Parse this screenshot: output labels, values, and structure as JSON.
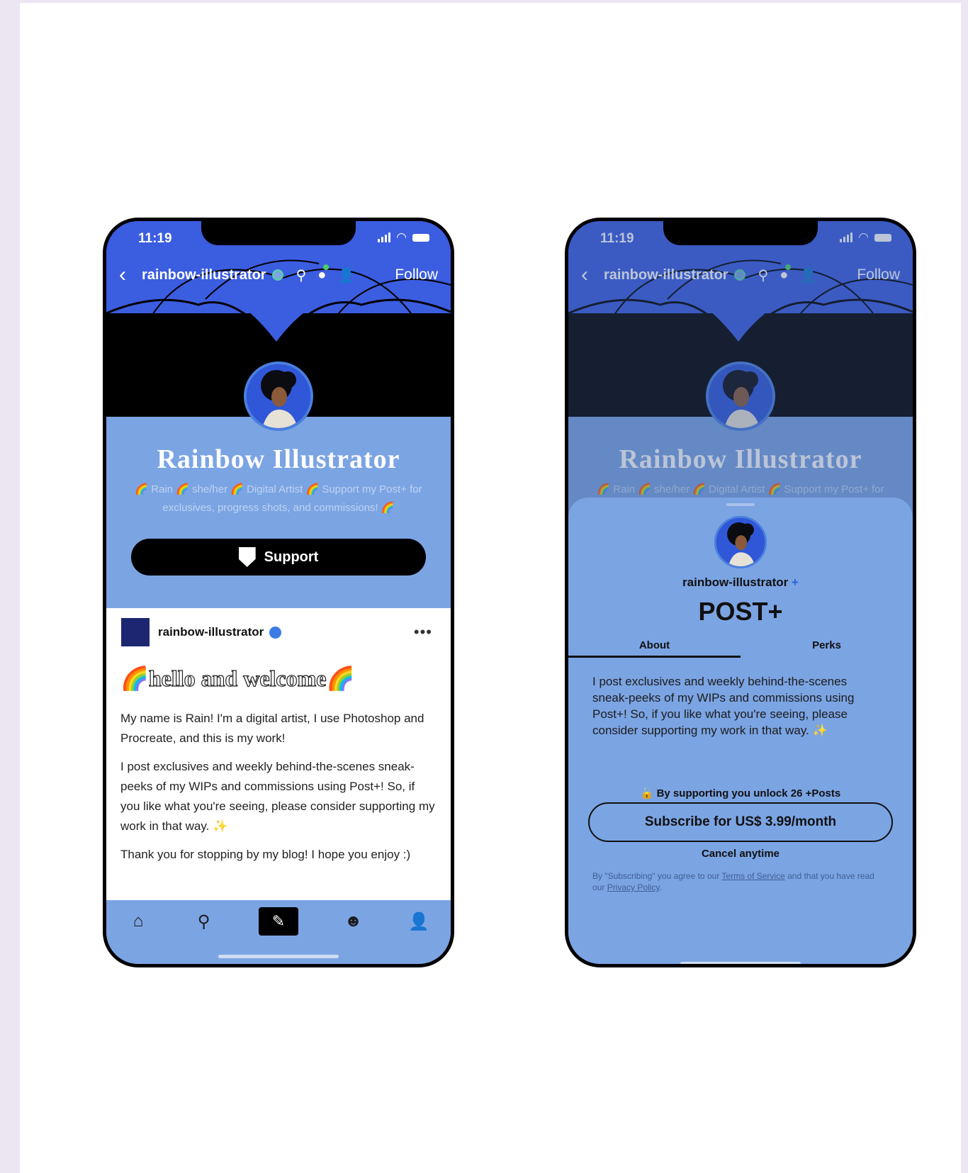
{
  "status": {
    "time": "11:19"
  },
  "nav": {
    "handle": "rainbow-illustrator",
    "follow": "Follow"
  },
  "profile": {
    "title": "Rainbow Illustrator",
    "description": "🌈 Rain 🌈 she/her 🌈 Digital Artist 🌈 Support my Post+ for exclusives, progress shots, and commissions! 🌈",
    "support_label": "Support"
  },
  "post": {
    "author": "rainbow-illustrator",
    "more": "•••",
    "title": "🌈hello and welcome🌈",
    "p1": "My name is Rain! I'm a digital artist, I use Photoshop and Procreate, and this is my work!",
    "p2": "I post exclusives and weekly behind-the-scenes sneak-peeks of my WIPs and commissions using Post+! So, if you like what you're seeing, please consider supporting my work in that way. ✨",
    "p3": "Thank you for stopping by my blog! I hope you enjoy :)"
  },
  "sheet": {
    "handle": "rainbow-illustrator",
    "handle_mark": "+",
    "title": "POST+",
    "tabs": [
      "About",
      "Perks"
    ],
    "about": "I post exclusives and weekly behind-the-scenes sneak-peeks of my WIPs and commissions using Post+! So, if you like what you're seeing, please consider supporting my work in that way. ✨",
    "unlock": "🔓 By supporting you unlock 26 +Posts",
    "subscribe": "Subscribe for US$ 3.99/month",
    "cancel": "Cancel anytime",
    "terms_prefix": "By \"Subscribing\" you agree to our ",
    "terms_link": "Terms of Service",
    "terms_mid": " and that you have read our ",
    "privacy_link": "Privacy Policy",
    "terms_suffix": "."
  },
  "colors": {
    "accent": "#7ba4e3",
    "header_blue": "#3b5de0",
    "brand_dark": "#000000"
  }
}
